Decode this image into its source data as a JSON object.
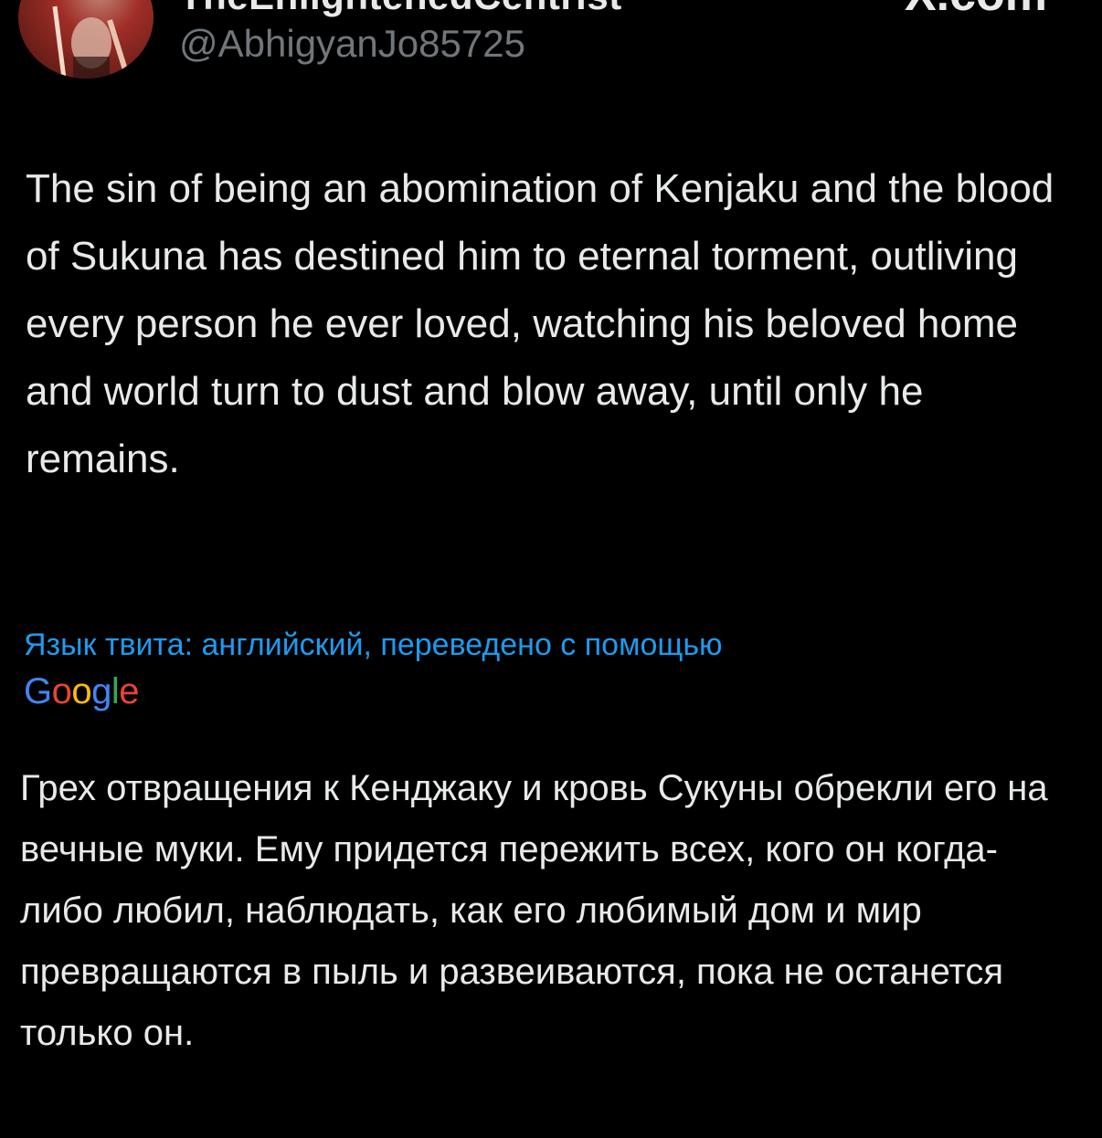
{
  "author": {
    "display_name": "TheEnlightenedCentrist",
    "handle": "@AbhigyanJo85725"
  },
  "site_mark": "X.com",
  "tweet": {
    "text": "The sin of being an abomination of Kenjaku and the blood of Sukuna has destined him to eternal torment, outliving every person he ever loved, watching his beloved home and world turn to dust and blow away, until only he remains."
  },
  "translation": {
    "note": "Язык твита: английский, переведено с помощью",
    "provider_letters": [
      "G",
      "o",
      "o",
      "g",
      "l",
      "e"
    ],
    "provider_colors": [
      "#4285f4",
      "#ea4335",
      "#fbbc05",
      "#4285f4",
      "#34a853",
      "#ea4335"
    ],
    "text": "Грех отвращения к Кенджаку и кровь Сукуны обрекли его на вечные муки. Ему придется пережить всех, кого он когда-либо любил, наблюдать, как его любимый дом и мир превращаются в пыль и развеиваются, пока не останется только он."
  },
  "colors": {
    "background": "#000000",
    "primary_text": "#e7e9ea",
    "secondary_text": "#71767b",
    "link": "#1d9bf0"
  }
}
